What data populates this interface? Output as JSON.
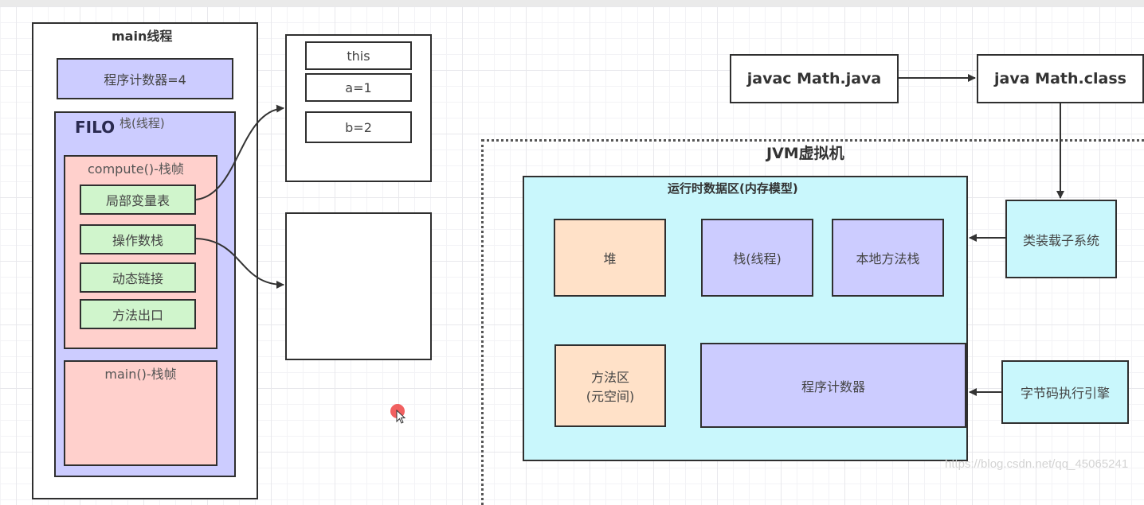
{
  "main_thread": {
    "title": "main线程",
    "program_counter": "程序计数器=4",
    "stack": {
      "filo_label": "FILO",
      "title": "栈(线程)",
      "compute_frame": {
        "title": "compute()-栈帧",
        "items": [
          "局部变量表",
          "操作数栈",
          "动态链接",
          "方法出口"
        ]
      },
      "main_frame": {
        "title": "main()-栈帧"
      }
    }
  },
  "local_vars_box": {
    "items": [
      "this",
      "a=1",
      "b=2"
    ]
  },
  "compile_flow": {
    "javac": "javac Math.java",
    "java": "java Math.class"
  },
  "jvm": {
    "title": "JVM虚拟机",
    "runtime_area": {
      "title": "运行时数据区(内存模型)",
      "heap": "堆",
      "stack": "栈(线程)",
      "native_stack": "本地方法栈",
      "method_area": "方法区",
      "method_area_sub": "(元空间)",
      "program_counter": "程序计数器"
    },
    "class_loader": "类装载子系统",
    "exec_engine": "字节码执行引擎"
  },
  "watermark": "https://blog.csdn.net/qq_45065241",
  "colors": {
    "lavender": "#ccccff",
    "salmon": "#ffd0cc",
    "green": "#d0f5cc",
    "peach": "#ffe1c8",
    "cyan": "#c9f7fc"
  }
}
